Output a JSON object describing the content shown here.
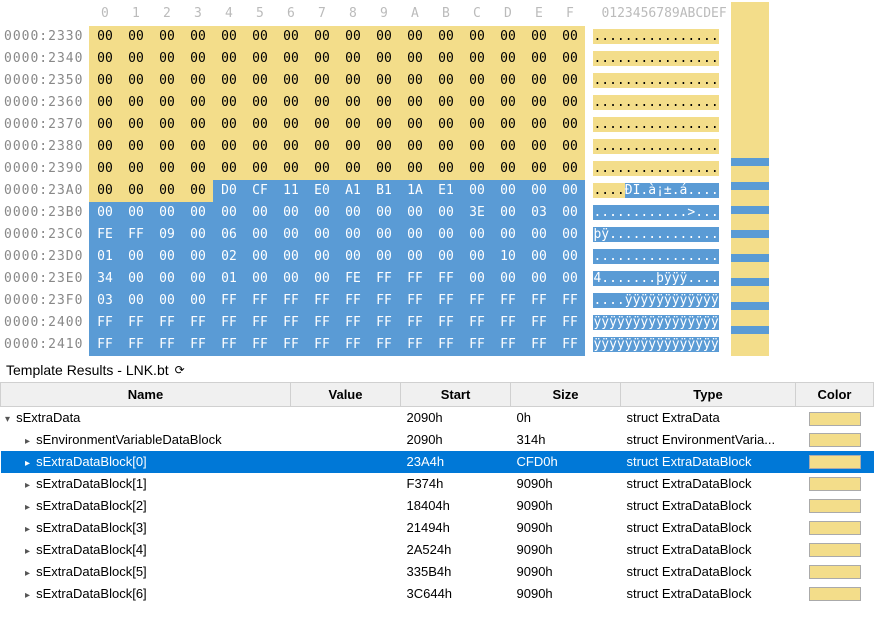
{
  "hex_header": {
    "cols": [
      "0",
      "1",
      "2",
      "3",
      "4",
      "5",
      "6",
      "7",
      "8",
      "9",
      "A",
      "B",
      "C",
      "D",
      "E",
      "F"
    ],
    "ascii": "0123456789ABCDEF"
  },
  "hex_rows": [
    {
      "addr": "0000:2330",
      "bytes": [
        "00",
        "00",
        "00",
        "00",
        "00",
        "00",
        "00",
        "00",
        "00",
        "00",
        "00",
        "00",
        "00",
        "00",
        "00",
        "00"
      ],
      "bg": [
        0,
        0,
        0,
        0,
        0,
        0,
        0,
        0,
        0,
        0,
        0,
        0,
        0,
        0,
        0,
        0
      ],
      "ascii": [
        {
          "t": "................",
          "c": 0
        }
      ]
    },
    {
      "addr": "0000:2340",
      "bytes": [
        "00",
        "00",
        "00",
        "00",
        "00",
        "00",
        "00",
        "00",
        "00",
        "00",
        "00",
        "00",
        "00",
        "00",
        "00",
        "00"
      ],
      "bg": [
        0,
        0,
        0,
        0,
        0,
        0,
        0,
        0,
        0,
        0,
        0,
        0,
        0,
        0,
        0,
        0
      ],
      "ascii": [
        {
          "t": "................",
          "c": 0
        }
      ]
    },
    {
      "addr": "0000:2350",
      "bytes": [
        "00",
        "00",
        "00",
        "00",
        "00",
        "00",
        "00",
        "00",
        "00",
        "00",
        "00",
        "00",
        "00",
        "00",
        "00",
        "00"
      ],
      "bg": [
        0,
        0,
        0,
        0,
        0,
        0,
        0,
        0,
        0,
        0,
        0,
        0,
        0,
        0,
        0,
        0
      ],
      "ascii": [
        {
          "t": "................",
          "c": 0
        }
      ]
    },
    {
      "addr": "0000:2360",
      "bytes": [
        "00",
        "00",
        "00",
        "00",
        "00",
        "00",
        "00",
        "00",
        "00",
        "00",
        "00",
        "00",
        "00",
        "00",
        "00",
        "00"
      ],
      "bg": [
        0,
        0,
        0,
        0,
        0,
        0,
        0,
        0,
        0,
        0,
        0,
        0,
        0,
        0,
        0,
        0
      ],
      "ascii": [
        {
          "t": "................",
          "c": 0
        }
      ]
    },
    {
      "addr": "0000:2370",
      "bytes": [
        "00",
        "00",
        "00",
        "00",
        "00",
        "00",
        "00",
        "00",
        "00",
        "00",
        "00",
        "00",
        "00",
        "00",
        "00",
        "00"
      ],
      "bg": [
        0,
        0,
        0,
        0,
        0,
        0,
        0,
        0,
        0,
        0,
        0,
        0,
        0,
        0,
        0,
        0
      ],
      "ascii": [
        {
          "t": "................",
          "c": 0
        }
      ]
    },
    {
      "addr": "0000:2380",
      "bytes": [
        "00",
        "00",
        "00",
        "00",
        "00",
        "00",
        "00",
        "00",
        "00",
        "00",
        "00",
        "00",
        "00",
        "00",
        "00",
        "00"
      ],
      "bg": [
        0,
        0,
        0,
        0,
        0,
        0,
        0,
        0,
        0,
        0,
        0,
        0,
        0,
        0,
        0,
        0
      ],
      "ascii": [
        {
          "t": "................",
          "c": 0
        }
      ]
    },
    {
      "addr": "0000:2390",
      "bytes": [
        "00",
        "00",
        "00",
        "00",
        "00",
        "00",
        "00",
        "00",
        "00",
        "00",
        "00",
        "00",
        "00",
        "00",
        "00",
        "00"
      ],
      "bg": [
        0,
        0,
        0,
        0,
        0,
        0,
        0,
        0,
        0,
        0,
        0,
        0,
        0,
        0,
        0,
        0
      ],
      "ascii": [
        {
          "t": "................",
          "c": 0
        }
      ]
    },
    {
      "addr": "0000:23A0",
      "bytes": [
        "00",
        "00",
        "00",
        "00",
        "D0",
        "CF",
        "11",
        "E0",
        "A1",
        "B1",
        "1A",
        "E1",
        "00",
        "00",
        "00",
        "00"
      ],
      "bg": [
        0,
        0,
        0,
        0,
        1,
        1,
        1,
        1,
        1,
        1,
        1,
        1,
        1,
        1,
        1,
        1
      ],
      "ascii": [
        {
          "t": "....",
          "c": 0
        },
        {
          "t": "ÐÏ.à¡±.á....",
          "c": 1
        }
      ]
    },
    {
      "addr": "0000:23B0",
      "bytes": [
        "00",
        "00",
        "00",
        "00",
        "00",
        "00",
        "00",
        "00",
        "00",
        "00",
        "00",
        "00",
        "3E",
        "00",
        "03",
        "00"
      ],
      "bg": [
        1,
        1,
        1,
        1,
        1,
        1,
        1,
        1,
        1,
        1,
        1,
        1,
        1,
        1,
        1,
        1
      ],
      "ascii": [
        {
          "t": "............>...",
          "c": 1
        }
      ]
    },
    {
      "addr": "0000:23C0",
      "bytes": [
        "FE",
        "FF",
        "09",
        "00",
        "06",
        "00",
        "00",
        "00",
        "00",
        "00",
        "00",
        "00",
        "00",
        "00",
        "00",
        "00"
      ],
      "bg": [
        1,
        1,
        1,
        1,
        1,
        1,
        1,
        1,
        1,
        1,
        1,
        1,
        1,
        1,
        1,
        1
      ],
      "ascii": [
        {
          "t": "þÿ..............",
          "c": 1
        }
      ]
    },
    {
      "addr": "0000:23D0",
      "bytes": [
        "01",
        "00",
        "00",
        "00",
        "02",
        "00",
        "00",
        "00",
        "00",
        "00",
        "00",
        "00",
        "00",
        "10",
        "00",
        "00"
      ],
      "bg": [
        1,
        1,
        1,
        1,
        1,
        1,
        1,
        1,
        1,
        1,
        1,
        1,
        1,
        1,
        1,
        1
      ],
      "ascii": [
        {
          "t": "................",
          "c": 1
        }
      ]
    },
    {
      "addr": "0000:23E0",
      "bytes": [
        "34",
        "00",
        "00",
        "00",
        "01",
        "00",
        "00",
        "00",
        "FE",
        "FF",
        "FF",
        "FF",
        "00",
        "00",
        "00",
        "00"
      ],
      "bg": [
        1,
        1,
        1,
        1,
        1,
        1,
        1,
        1,
        1,
        1,
        1,
        1,
        1,
        1,
        1,
        1
      ],
      "ascii": [
        {
          "t": "4.......þÿÿÿ....",
          "c": 1
        }
      ]
    },
    {
      "addr": "0000:23F0",
      "bytes": [
        "03",
        "00",
        "00",
        "00",
        "FF",
        "FF",
        "FF",
        "FF",
        "FF",
        "FF",
        "FF",
        "FF",
        "FF",
        "FF",
        "FF",
        "FF"
      ],
      "bg": [
        1,
        1,
        1,
        1,
        1,
        1,
        1,
        1,
        1,
        1,
        1,
        1,
        1,
        1,
        1,
        1
      ],
      "ascii": [
        {
          "t": "....ÿÿÿÿÿÿÿÿÿÿÿÿ",
          "c": 1
        }
      ]
    },
    {
      "addr": "0000:2400",
      "bytes": [
        "FF",
        "FF",
        "FF",
        "FF",
        "FF",
        "FF",
        "FF",
        "FF",
        "FF",
        "FF",
        "FF",
        "FF",
        "FF",
        "FF",
        "FF",
        "FF"
      ],
      "bg": [
        1,
        1,
        1,
        1,
        1,
        1,
        1,
        1,
        1,
        1,
        1,
        1,
        1,
        1,
        1,
        1
      ],
      "ascii": [
        {
          "t": "ÿÿÿÿÿÿÿÿÿÿÿÿÿÿÿÿ",
          "c": 1
        }
      ]
    },
    {
      "addr": "0000:2410",
      "bytes": [
        "FF",
        "FF",
        "FF",
        "FF",
        "FF",
        "FF",
        "FF",
        "FF",
        "FF",
        "FF",
        "FF",
        "FF",
        "FF",
        "FF",
        "FF",
        "FF"
      ],
      "bg": [
        1,
        1,
        1,
        1,
        1,
        1,
        1,
        1,
        1,
        1,
        1,
        1,
        1,
        1,
        1,
        1
      ],
      "ascii": [
        {
          "t": "ÿÿÿÿÿÿÿÿÿÿÿÿÿÿÿÿ",
          "c": 1
        }
      ]
    }
  ],
  "panel_title": "Template Results - LNK.bt",
  "columns": {
    "name": "Name",
    "value": "Value",
    "start": "Start",
    "size": "Size",
    "type": "Type",
    "color": "Color"
  },
  "rows": [
    {
      "indent": 0,
      "exp": "down",
      "name": "sExtraData",
      "value": "",
      "start": "2090h",
      "size": "0h",
      "type": "struct ExtraData",
      "selected": false
    },
    {
      "indent": 1,
      "exp": "right",
      "name": "sEnvironmentVariableDataBlock",
      "value": "",
      "start": "2090h",
      "size": "314h",
      "type": "struct EnvironmentVaria...",
      "selected": false
    },
    {
      "indent": 1,
      "exp": "right",
      "name": "sExtraDataBlock[0]",
      "value": "",
      "start": "23A4h",
      "size": "CFD0h",
      "type": "struct ExtraDataBlock",
      "selected": true
    },
    {
      "indent": 1,
      "exp": "right",
      "name": "sExtraDataBlock[1]",
      "value": "",
      "start": "F374h",
      "size": "9090h",
      "type": "struct ExtraDataBlock",
      "selected": false
    },
    {
      "indent": 1,
      "exp": "right",
      "name": "sExtraDataBlock[2]",
      "value": "",
      "start": "18404h",
      "size": "9090h",
      "type": "struct ExtraDataBlock",
      "selected": false
    },
    {
      "indent": 1,
      "exp": "right",
      "name": "sExtraDataBlock[3]",
      "value": "",
      "start": "21494h",
      "size": "9090h",
      "type": "struct ExtraDataBlock",
      "selected": false
    },
    {
      "indent": 1,
      "exp": "right",
      "name": "sExtraDataBlock[4]",
      "value": "",
      "start": "2A524h",
      "size": "9090h",
      "type": "struct ExtraDataBlock",
      "selected": false
    },
    {
      "indent": 1,
      "exp": "right",
      "name": "sExtraDataBlock[5]",
      "value": "",
      "start": "335B4h",
      "size": "9090h",
      "type": "struct ExtraDataBlock",
      "selected": false
    },
    {
      "indent": 1,
      "exp": "right",
      "name": "sExtraDataBlock[6]",
      "value": "",
      "start": "3C644h",
      "size": "9090h",
      "type": "struct ExtraDataBlock",
      "selected": false
    }
  ]
}
